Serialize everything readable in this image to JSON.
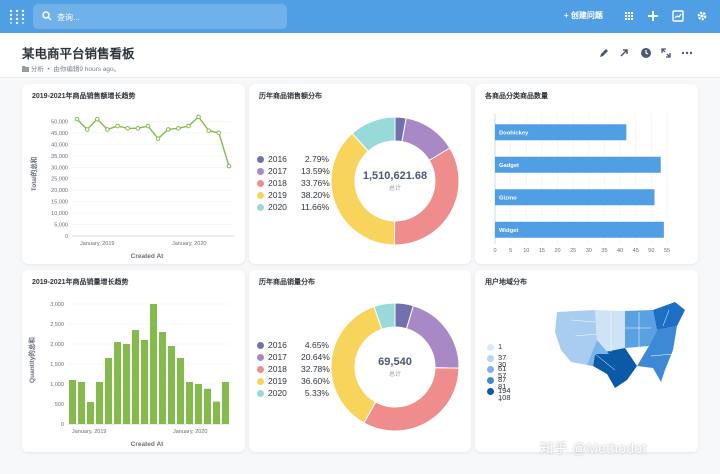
{
  "topbar": {
    "search_placeholder": "查询...",
    "new_question_label": "创建问题"
  },
  "header": {
    "title": "某电商平台销售看板",
    "collection": "分析",
    "edited": "由你编辑9 hours ago。"
  },
  "cards": {
    "revenue_trend": {
      "title": "2019-2021年商品销售额增长趋势",
      "ylabel": "Total的总和",
      "xlabel": "Created At"
    },
    "revenue_share": {
      "title": "历年商品销售额分布",
      "total": "1,510,621.68",
      "total_label": "总计"
    },
    "category_count": {
      "title": "各商品分类商品数量"
    },
    "quantity_trend": {
      "title": "2019-2021年商品销量增长趋势",
      "ylabel": "Quantity的总和",
      "xlabel": "Created At"
    },
    "quantity_share": {
      "title": "历年商品销量分布",
      "total": "69,540",
      "total_label": "总计"
    },
    "user_map": {
      "title": "用户地域分布"
    }
  },
  "colors": {
    "accent": "#509ee3",
    "green": "#84bb4c",
    "y2016": "#7172ad",
    "y2017": "#a989c5",
    "y2018": "#ef8c8c",
    "y2019": "#f9d45c",
    "y2020": "#98d9d9"
  },
  "chart_data": [
    {
      "type": "line",
      "title": "2019-2021年商品销售额增长趋势",
      "xlabel": "Created At",
      "ylabel": "Total的总和",
      "ylim": [
        0,
        55000
      ],
      "yticks": [
        "0",
        "5,000",
        "10,000",
        "15,000",
        "20,000",
        "25,000",
        "30,000",
        "35,000",
        "40,000",
        "45,000",
        "50,000"
      ],
      "xticks": [
        "January, 2019",
        "January, 2020"
      ],
      "values": [
        51000,
        46500,
        51000,
        46500,
        48000,
        47000,
        47000,
        48000,
        42500,
        46500,
        47000,
        48000,
        52000,
        46000,
        45000,
        30500
      ]
    },
    {
      "type": "pie",
      "title": "历年商品销售额分布",
      "total": "1,510,621.68",
      "slices": [
        {
          "label": "2016",
          "value": 2.79,
          "pct": "2.79%"
        },
        {
          "label": "2017",
          "value": 13.59,
          "pct": "13.59%"
        },
        {
          "label": "2018",
          "value": 33.76,
          "pct": "33.76%"
        },
        {
          "label": "2019",
          "value": 38.2,
          "pct": "38.20%"
        },
        {
          "label": "2020",
          "value": 11.66,
          "pct": "11.66%"
        }
      ]
    },
    {
      "type": "bar",
      "title": "各商品分类商品数量",
      "categories": [
        "Doohickey",
        "Gadget",
        "Gizmo",
        "Widget"
      ],
      "values": [
        42,
        53,
        51,
        54
      ],
      "xlim": [
        0,
        55
      ],
      "xticks": [
        "0",
        "5",
        "10",
        "15",
        "20",
        "25",
        "30",
        "35",
        "40",
        "45",
        "50",
        "55"
      ]
    },
    {
      "type": "bar",
      "title": "2019-2021年商品销量增长趋势",
      "xlabel": "Created At",
      "ylabel": "Quantity的总和",
      "ylim": [
        0,
        3200
      ],
      "yticks": [
        "0",
        "500",
        "1,000",
        "1,500",
        "2,000",
        "2,500",
        "3,000"
      ],
      "xticks": [
        "January, 2019",
        "January, 2020"
      ],
      "values": [
        1100,
        1050,
        550,
        1050,
        1650,
        2050,
        2000,
        2350,
        2100,
        3000,
        2300,
        1950,
        1650,
        1050,
        1000,
        880,
        560,
        1050
      ]
    },
    {
      "type": "pie",
      "title": "历年商品销量分布",
      "total": "69,540",
      "slices": [
        {
          "label": "2016",
          "value": 4.65,
          "pct": "4.65%"
        },
        {
          "label": "2017",
          "value": 20.64,
          "pct": "20.64%"
        },
        {
          "label": "2018",
          "value": 32.78,
          "pct": "32.78%"
        },
        {
          "label": "2019",
          "value": 36.6,
          "pct": "36.60%"
        },
        {
          "label": "2020",
          "value": 5.33,
          "pct": "5.33%"
        }
      ]
    }
  ],
  "map_legend": [
    "1 - 30",
    "37 - 57",
    "61 - 81",
    "87 - 108",
    "194 +"
  ],
  "watermark": "知乎 @Methodot"
}
